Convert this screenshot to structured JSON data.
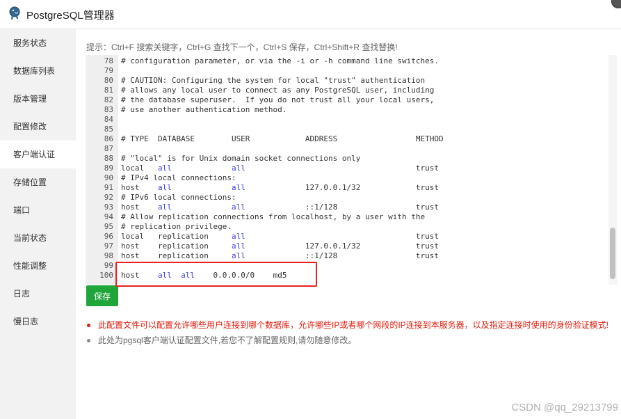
{
  "window": {
    "title": "PostgreSQL管理器"
  },
  "sidebar": {
    "items": [
      {
        "label": "服务状态",
        "active": false
      },
      {
        "label": "数据库列表",
        "active": false
      },
      {
        "label": "版本管理",
        "active": false
      },
      {
        "label": "配置修改",
        "active": false
      },
      {
        "label": "客户端认证",
        "active": true
      },
      {
        "label": "存储位置",
        "active": false
      },
      {
        "label": "端口",
        "active": false
      },
      {
        "label": "当前状态",
        "active": false
      },
      {
        "label": "性能调整",
        "active": false
      },
      {
        "label": "日志",
        "active": false
      },
      {
        "label": "慢日志",
        "active": false
      }
    ]
  },
  "main": {
    "hint": "提示：Ctrl+F 搜索关键字，Ctrl+G 查找下一个，Ctrl+S 保存，Ctrl+Shift+R 查找替换!",
    "editor": {
      "lines": [
        {
          "n": "78",
          "text": "# configuration parameter, or via the -i or -h command line switches."
        },
        {
          "n": "79",
          "text": ""
        },
        {
          "n": "80",
          "text": "# CAUTION: Configuring the system for local \"trust\" authentication"
        },
        {
          "n": "81",
          "text": "# allows any local user to connect as any PostgreSQL user, including"
        },
        {
          "n": "82",
          "text": "# the database superuser.  If you do not trust all your local users,"
        },
        {
          "n": "83",
          "text": "# use another authentication method."
        },
        {
          "n": "84",
          "text": ""
        },
        {
          "n": "85",
          "text": ""
        },
        {
          "n": "86",
          "text": "# TYPE  DATABASE        USER            ADDRESS                 METHOD"
        },
        {
          "n": "87",
          "text": ""
        },
        {
          "n": "88",
          "text": "# \"local\" is for Unix domain socket connections only"
        },
        {
          "n": "89",
          "text": "local   |all|             |all|                                     trust"
        },
        {
          "n": "90",
          "text": "# IPv4 local connections:"
        },
        {
          "n": "91",
          "text": "host    |all|             |all|             127.0.0.1/32            trust"
        },
        {
          "n": "92",
          "text": "# IPv6 local connections:"
        },
        {
          "n": "93",
          "text": "host    |all|             |all|             ::1/128                 trust"
        },
        {
          "n": "94",
          "text": "# Allow replication connections from localhost, by a user with the"
        },
        {
          "n": "95",
          "text": "# replication privilege."
        },
        {
          "n": "96",
          "text": "local   replication     |all|                                     trust"
        },
        {
          "n": "97",
          "text": "host    replication     |all|             127.0.0.1/32            trust"
        },
        {
          "n": "98",
          "text": "host    replication     |all|             ::1/128                 trust"
        },
        {
          "n": "99",
          "text": ""
        },
        {
          "n": "100",
          "text": "host    |all|  |all|    0.0.0.0/0    md5"
        }
      ]
    },
    "save_label": "保存",
    "notes": [
      {
        "text": "此配置文件可以配置允许哪些用户连接到哪个数据库，允许哪些IP或者哪个网段的IP连接到本服务器，以及指定连接时使用的身份验证模式!",
        "color": "#e01b0c"
      },
      {
        "text": "此处为pgsql客户端认证配置文件,若您不了解配置规则,请勿随意修改。",
        "color": "#666666"
      }
    ]
  },
  "watermark": "CSDN @qq_29213799",
  "colors": {
    "accent": "#20a53a",
    "keyword": "#3b3be0",
    "highlight": "#e8231f"
  }
}
